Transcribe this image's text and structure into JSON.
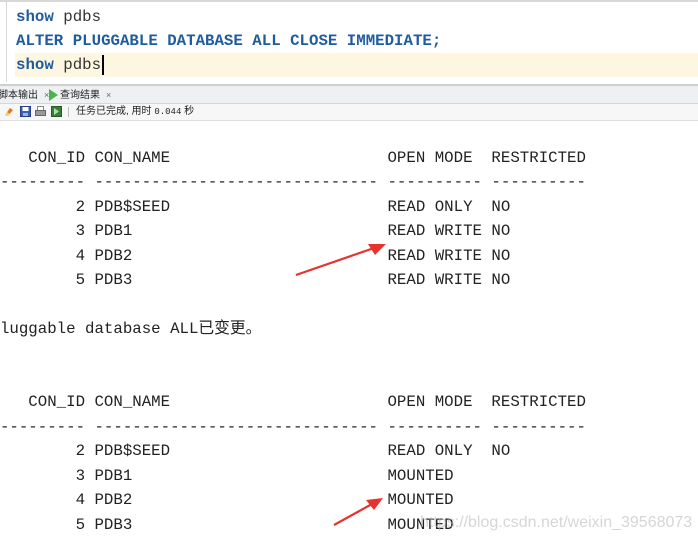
{
  "editor": {
    "lines": [
      {
        "keyword": "show",
        "rest": " pdbs"
      },
      {
        "keyword": "ALTER PLUGGABLE DATABASE ALL CLOSE IMMEDIATE;",
        "rest": ""
      },
      {
        "keyword": "show",
        "rest": " pdbs"
      }
    ]
  },
  "panel": {
    "tabs": [
      {
        "label": "脚本输出",
        "close": "×"
      },
      {
        "label": "查询结果",
        "close": "×",
        "icon": "play-icon"
      }
    ],
    "toolbar": {
      "icons": [
        "eraser-icon",
        "save-icon",
        "print-icon",
        "export-icon"
      ],
      "status_prefix": "任务已完成, 用时",
      "elapsed": "0.044",
      "unit": "秒"
    }
  },
  "output": {
    "lines": [
      "",
      "    CON_ID CON_NAME                       OPEN MODE  RESTRICTED",
      "---------- ------------------------------ ---------- ----------",
      "         2 PDB$SEED                       READ ONLY  NO",
      "         3 PDB1                           READ WRITE NO",
      "         4 PDB2                           READ WRITE NO",
      "         5 PDB3                           READ WRITE NO",
      "",
      "Pluggable database ALL已变更。",
      "",
      "",
      "    CON_ID CON_NAME                       OPEN MODE  RESTRICTED",
      "---------- ------------------------------ ---------- ----------",
      "         2 PDB$SEED                       READ ONLY  NO",
      "         3 PDB1                           MOUNTED",
      "         4 PDB2                           MOUNTED",
      "         5 PDB3                           MOUNTED"
    ]
  },
  "annotations": {
    "arrow_color": "#e8322e"
  },
  "watermark": "https://blog.csdn.net/weixin_39568073"
}
